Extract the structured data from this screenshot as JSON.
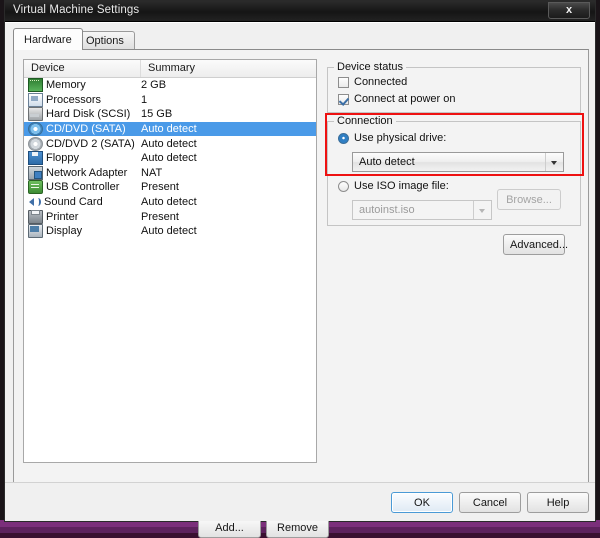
{
  "window": {
    "title": "Virtual Machine Settings",
    "close_label": "x"
  },
  "tabs": [
    {
      "label": "Hardware",
      "active": true
    },
    {
      "label": "Options",
      "active": false
    }
  ],
  "device_list": {
    "columns": [
      "Device",
      "Summary"
    ],
    "rows": [
      {
        "icon": "memory-icon",
        "device": "Memory",
        "summary": "2 GB",
        "selected": false
      },
      {
        "icon": "processor-icon",
        "device": "Processors",
        "summary": "1",
        "selected": false
      },
      {
        "icon": "hard-disk-icon",
        "device": "Hard Disk (SCSI)",
        "summary": "15 GB",
        "selected": false
      },
      {
        "icon": "cd-dvd-icon",
        "device": "CD/DVD (SATA)",
        "summary": "Auto detect",
        "selected": true
      },
      {
        "icon": "cd-dvd-secondary-icon",
        "device": "CD/DVD 2 (SATA)",
        "summary": "Auto detect",
        "selected": false
      },
      {
        "icon": "floppy-icon",
        "device": "Floppy",
        "summary": "Auto detect",
        "selected": false
      },
      {
        "icon": "network-adapter-icon",
        "device": "Network Adapter",
        "summary": "NAT",
        "selected": false
      },
      {
        "icon": "usb-controller-icon",
        "device": "USB Controller",
        "summary": "Present",
        "selected": false
      },
      {
        "icon": "sound-card-icon",
        "device": "Sound Card",
        "summary": "Auto detect",
        "selected": false
      },
      {
        "icon": "printer-icon",
        "device": "Printer",
        "summary": "Present",
        "selected": false
      },
      {
        "icon": "display-icon",
        "device": "Display",
        "summary": "Auto detect",
        "selected": false
      }
    ],
    "add_label": "Add...",
    "remove_label": "Remove"
  },
  "device_status": {
    "group_title": "Device status",
    "connected": {
      "label": "Connected",
      "checked": false
    },
    "connect_at_power_on": {
      "label": "Connect at power on",
      "checked": true
    }
  },
  "connection": {
    "group_title": "Connection",
    "use_physical_drive": {
      "label": "Use physical drive:",
      "selected": true
    },
    "physical_drive_value": "Auto detect",
    "use_iso_image": {
      "label": "Use ISO image file:",
      "selected": false
    },
    "iso_path_value": "autoinst.iso",
    "browse_label": "Browse...",
    "highlight_color": "#ee1111"
  },
  "advanced_label": "Advanced...",
  "footer": {
    "ok_label": "OK",
    "cancel_label": "Cancel",
    "help_label": "Help"
  }
}
